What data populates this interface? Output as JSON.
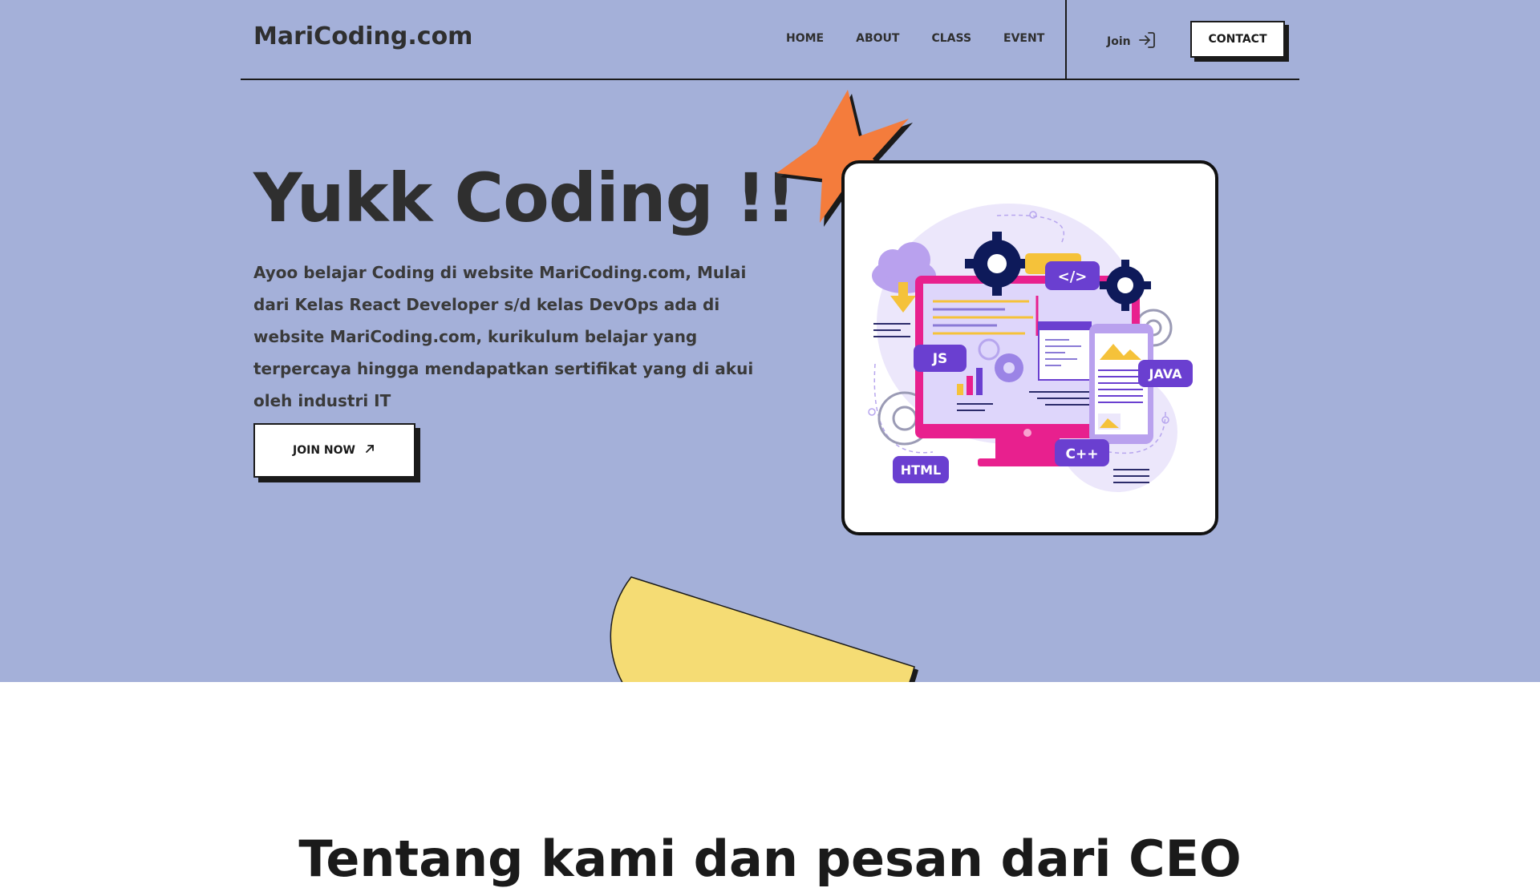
{
  "nav": {
    "logo": "MariCoding.com",
    "links": [
      "HOME",
      "ABOUT",
      "CLASS",
      "EVENT"
    ],
    "join_label": "Join",
    "contact_label": "CONTACT"
  },
  "hero": {
    "title": "Yukk Coding !!",
    "description": "Ayoo belajar Coding di website MariCoding.com, Mulai dari Kelas React Developer s/d kelas DevOps ada di website MariCoding.com, kurikulum belajar yang terpercaya hingga mendapatkan sertifikat yang di akui oleh industri IT",
    "cta_label": "JOIN NOW"
  },
  "illustration": {
    "tags": [
      "</>",
      "JS",
      "JAVA",
      "HTML",
      "C++"
    ]
  },
  "about": {
    "title": "Tentang kami dan pesan dari CEO"
  },
  "colors": {
    "hero_bg": "#a4b0d9",
    "star": "#f47c3c",
    "half_disc": "#f5dc74",
    "tag_purple": "#6a3fd0",
    "monitor_pink": "#e8208e",
    "gear_navy": "#0e1a5a"
  },
  "icons": {
    "join": "sign-in-icon",
    "cta": "arrow-up-right-icon"
  }
}
